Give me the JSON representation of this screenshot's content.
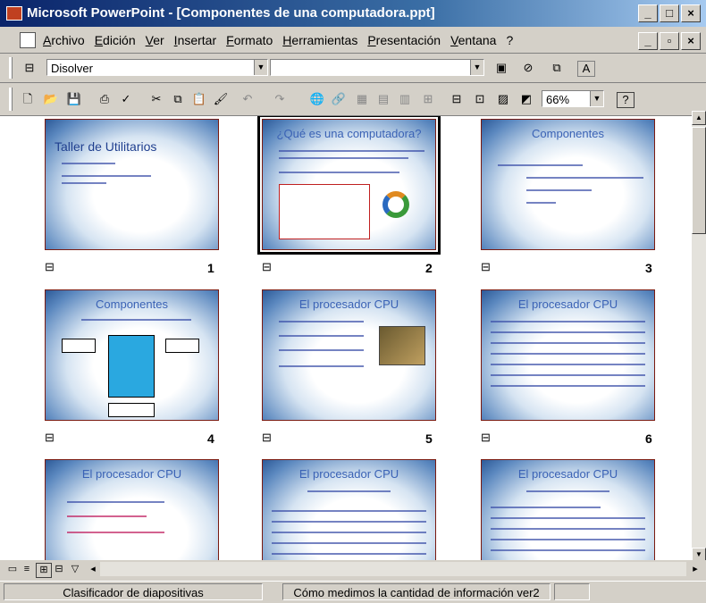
{
  "window": {
    "title": "Microsoft PowerPoint - [Componentes de una computadora.ppt]"
  },
  "menu": [
    "Archivo",
    "Edición",
    "Ver",
    "Insertar",
    "Formato",
    "Herramientas",
    "Presentación",
    "Ventana",
    "?"
  ],
  "toolbar": {
    "transition_value": "Disolver",
    "zoom_value": "66%"
  },
  "slides": [
    {
      "number": "1",
      "title": "Taller de Utilitarios"
    },
    {
      "number": "2",
      "title": "¿Qué es una computadora?"
    },
    {
      "number": "3",
      "title": "Componentes"
    },
    {
      "number": "4",
      "title": "Componentes"
    },
    {
      "number": "5",
      "title": "El procesador CPU"
    },
    {
      "number": "6",
      "title": "El procesador CPU"
    },
    {
      "number": "",
      "title": "El procesador CPU"
    },
    {
      "number": "",
      "title": "El procesador CPU"
    },
    {
      "number": "",
      "title": "El procesador CPU"
    }
  ],
  "status": {
    "view": "Clasificador de diapositivas",
    "design": "Cómo medimos la cantidad de información ver2"
  }
}
